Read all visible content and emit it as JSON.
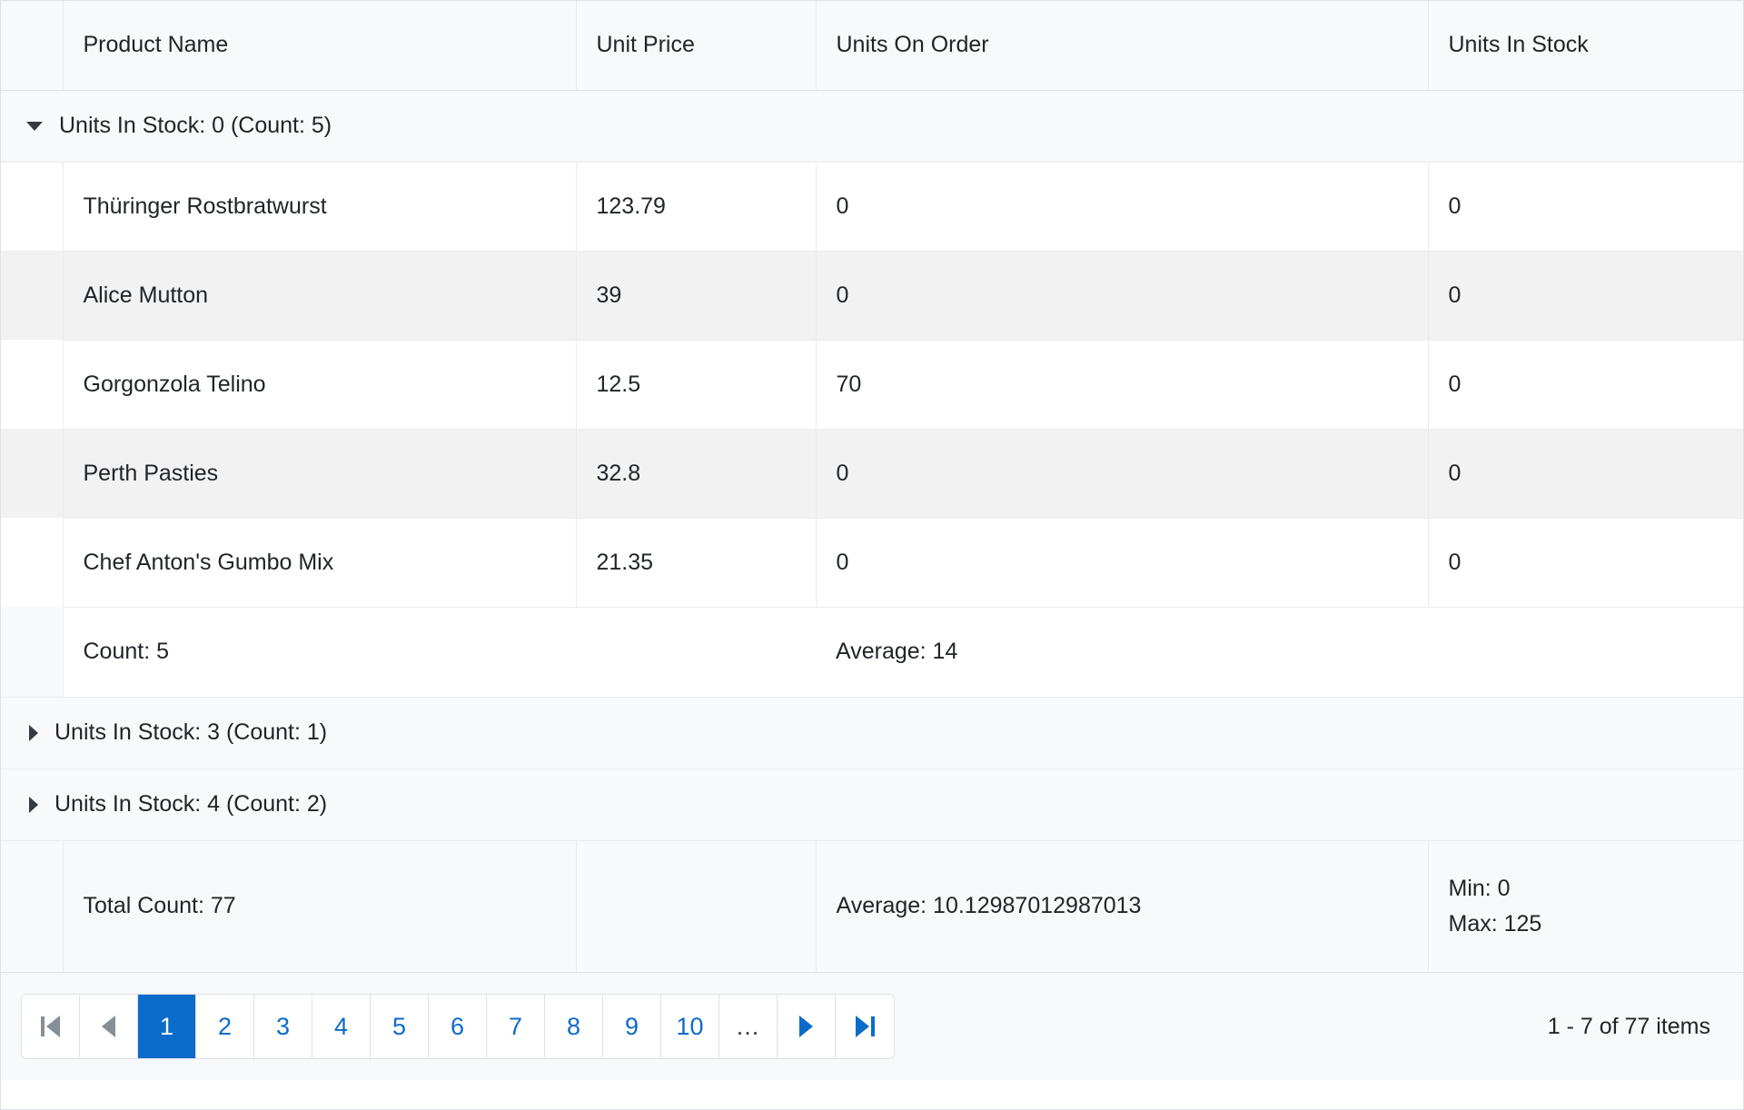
{
  "columns": [
    {
      "key": "product_name",
      "label": "Product Name"
    },
    {
      "key": "unit_price",
      "label": "Unit Price"
    },
    {
      "key": "units_on_order",
      "label": "Units On Order"
    },
    {
      "key": "units_in_stock",
      "label": "Units In Stock"
    }
  ],
  "groups": [
    {
      "label": "Units In Stock: 0 (Count: 5)",
      "expanded": true,
      "toggle_icon": "chevron-down-icon",
      "rows": [
        {
          "product_name": "Thüringer Rostbratwurst",
          "unit_price": "123.79",
          "units_on_order": "0",
          "units_in_stock": "0"
        },
        {
          "product_name": "Alice Mutton",
          "unit_price": "39",
          "units_on_order": "0",
          "units_in_stock": "0"
        },
        {
          "product_name": "Gorgonzola Telino",
          "unit_price": "12.5",
          "units_on_order": "70",
          "units_in_stock": "0"
        },
        {
          "product_name": "Perth Pasties",
          "unit_price": "32.8",
          "units_on_order": "0",
          "units_in_stock": "0"
        },
        {
          "product_name": "Chef Anton's Gumbo Mix",
          "unit_price": "21.35",
          "units_on_order": "0",
          "units_in_stock": "0"
        }
      ],
      "footer": {
        "product_name": "Count: 5",
        "unit_price": "",
        "units_on_order": "Average: 14",
        "units_in_stock": ""
      }
    },
    {
      "label": "Units In Stock: 3 (Count: 1)",
      "expanded": false,
      "toggle_icon": "chevron-right-icon",
      "rows": [],
      "footer": null
    },
    {
      "label": "Units In Stock: 4 (Count: 2)",
      "expanded": false,
      "toggle_icon": "chevron-right-icon",
      "rows": [],
      "footer": null
    }
  ],
  "grand_footer": {
    "product_name": "Total Count: 77",
    "unit_price": "",
    "units_on_order": "Average: 10.12987012987013",
    "units_in_stock_min": "Min: 0",
    "units_in_stock_max": "Max: 125"
  },
  "pager": {
    "first_icon": "go-to-first-page-icon",
    "prev_icon": "previous-page-icon",
    "next_icon": "next-page-icon",
    "last_icon": "go-to-last-page-icon",
    "pages": [
      "1",
      "2",
      "3",
      "4",
      "5",
      "6",
      "7",
      "8",
      "9",
      "10"
    ],
    "ellipsis": "...",
    "current_page": "1",
    "info": "1 - 7 of 77 items"
  },
  "colors": {
    "accent": "#0b6bcb",
    "header_bg": "#f8f9fa",
    "alt_row_bg": "#f2f2f2",
    "border": "#dee2e6"
  }
}
